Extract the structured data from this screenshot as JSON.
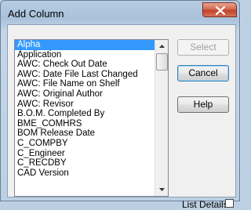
{
  "window": {
    "title": "Add Column"
  },
  "listbox": {
    "selected_index": 0,
    "items": [
      "Alpha",
      "Application",
      "AWC: Check Out Date",
      "AWC: Date File Last Changed",
      "AWC: File Name on Shelf",
      "AWC: Original Author",
      "AWC: Revisor",
      "B.O.M. Completed By",
      "BME_COMHRS",
      "BOM Release Date",
      "C_COMPBY",
      "C_Engineer",
      "C_RECDBY",
      "CAD Version"
    ]
  },
  "buttons": {
    "select": "Select",
    "cancel": "Cancel",
    "help": "Help"
  },
  "options": {
    "list_details_label": "List Details",
    "list_details_checked": false
  },
  "colors": {
    "selection": "#3399ff",
    "close_button": "#c1402a"
  }
}
